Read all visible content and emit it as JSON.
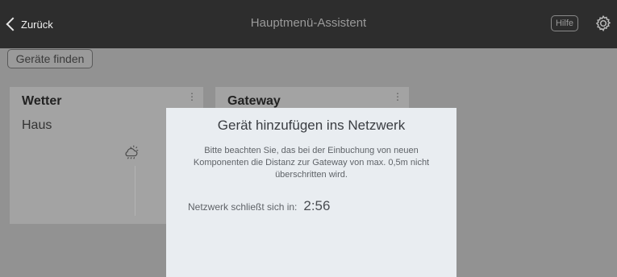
{
  "topbar": {
    "back_label": "Zurück",
    "title": "Hauptmenü-Assistent",
    "help_label": "Hilfe",
    "settings_icon": "gear-icon"
  },
  "toolbar": {
    "find_devices_label": "Geräte finden"
  },
  "cards": [
    {
      "name": "Wetter",
      "subtitle": "Haus",
      "icon": "weather-icon",
      "menu": "⋮"
    },
    {
      "name": "Gateway",
      "subtitle": "",
      "icon": "",
      "menu": "⋮"
    }
  ],
  "dialog": {
    "title": "Gerät hinzufügen ins Netzwerk",
    "body": "Bitte beachten Sie, das bei der Einbuchung von neuen Komponenten die Distanz zur Gateway von max. 0,5m nicht überschritten wird.",
    "closes_label": "Netzwerk schließt sich in:",
    "closes_time": "2:56"
  },
  "colors": {
    "topbar": "#2d2d2d",
    "overlay": "#929292",
    "dialog": "#e9edf1"
  }
}
